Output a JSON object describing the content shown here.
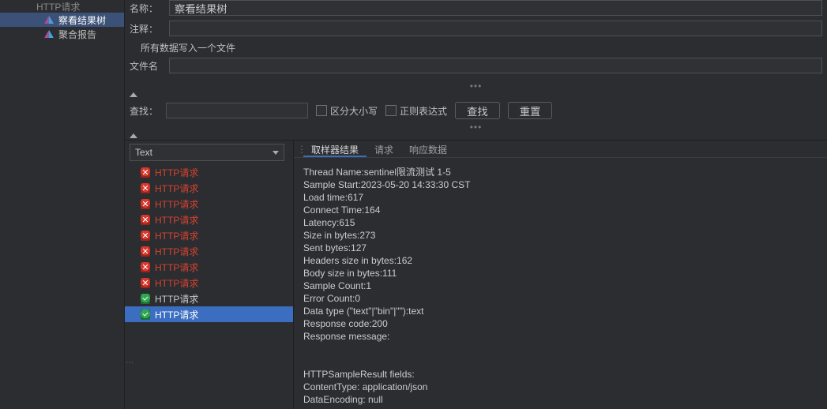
{
  "sidebar": {
    "top_truncated": "HTTP请求",
    "items": [
      {
        "label": "察看结果树",
        "selected": true
      },
      {
        "label": "聚合报告",
        "selected": false
      }
    ]
  },
  "form": {
    "name_label": "名称：",
    "name_value": "察看结果树",
    "comment_label": "注释：",
    "comment_value": "",
    "writeall": "所有数据写入一个文件",
    "file_label": "文件名",
    "file_value": ""
  },
  "search": {
    "label": "查找：",
    "value": "",
    "case_label": "区分大小写",
    "regex_label": "正则表达式",
    "find_btn": "查找",
    "reset_btn": "重置"
  },
  "renderer": {
    "selected": "Text"
  },
  "results": [
    {
      "label": "HTTP请求",
      "status": "fail"
    },
    {
      "label": "HTTP请求",
      "status": "fail"
    },
    {
      "label": "HTTP请求",
      "status": "fail"
    },
    {
      "label": "HTTP请求",
      "status": "fail"
    },
    {
      "label": "HTTP请求",
      "status": "fail"
    },
    {
      "label": "HTTP请求",
      "status": "fail"
    },
    {
      "label": "HTTP请求",
      "status": "fail"
    },
    {
      "label": "HTTP请求",
      "status": "fail"
    },
    {
      "label": "HTTP请求",
      "status": "ok"
    },
    {
      "label": "HTTP请求",
      "status": "ok",
      "selected": true
    }
  ],
  "tabs": {
    "items": [
      "取样器结果",
      "请求",
      "响应数据"
    ],
    "active": 0
  },
  "detail_lines": [
    "Thread Name:sentinel限流测试 1-5",
    "Sample Start:2023-05-20 14:33:30 CST",
    "Load time:617",
    "Connect Time:164",
    "Latency:615",
    "Size in bytes:273",
    "Sent bytes:127",
    "Headers size in bytes:162",
    "Body size in bytes:111",
    "Sample Count:1",
    "Error Count:0",
    "Data type (\"text\"|\"bin\"|\"\"):text",
    "Response code:200",
    "Response message:",
    "",
    "",
    "HTTPSampleResult fields:",
    "ContentType: application/json",
    "DataEncoding: null"
  ]
}
